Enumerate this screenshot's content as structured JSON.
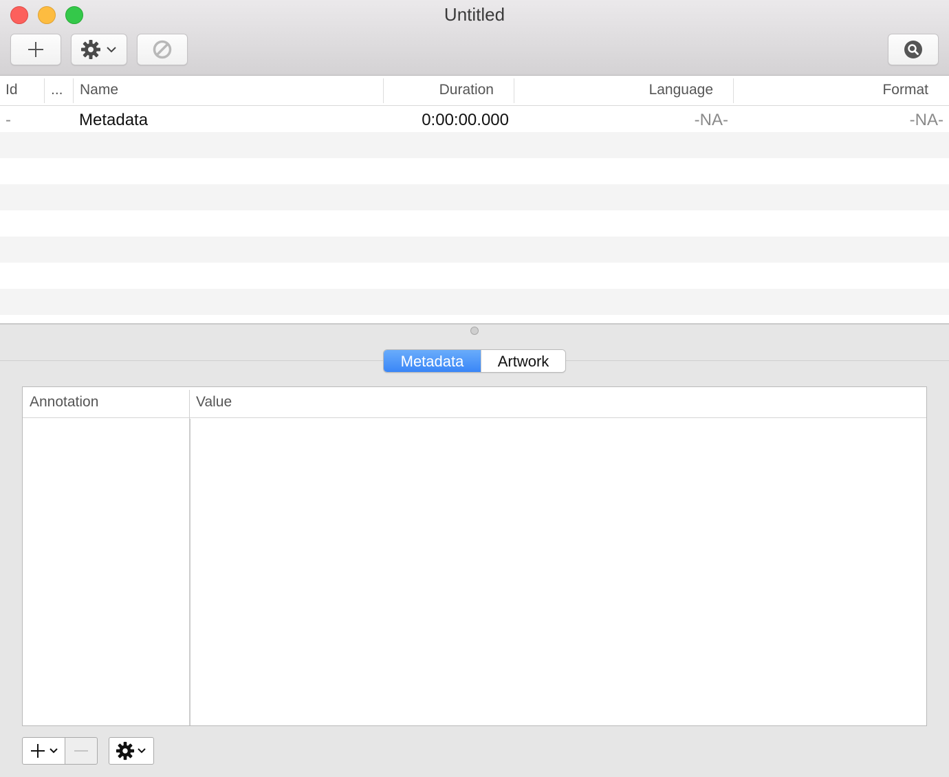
{
  "window": {
    "title": "Untitled"
  },
  "toolbar": {
    "buttons": [
      {
        "name": "add",
        "icon": "plus-icon"
      },
      {
        "name": "actions",
        "icon": "gear-dropdown-icon"
      },
      {
        "name": "cancel",
        "icon": "prohibited-icon"
      },
      {
        "name": "search",
        "icon": "magnifier-icon"
      }
    ]
  },
  "tracks": {
    "columns": [
      "Id",
      "...",
      "Name",
      "Duration",
      "Language",
      "Format"
    ],
    "rows": [
      {
        "id": "-",
        "name": "Metadata",
        "duration": "0:00:00.000",
        "language": "-NA-",
        "format": "-NA-"
      }
    ]
  },
  "tabs": {
    "items": [
      "Metadata",
      "Artwork"
    ],
    "selected": "Metadata"
  },
  "metadata_table": {
    "columns": [
      "Annotation",
      "Value"
    ],
    "rows": []
  },
  "footer": {
    "buttons": [
      {
        "name": "add-annotation",
        "icon": "plus-dropdown-icon"
      },
      {
        "name": "remove-annotation",
        "icon": "minus-icon",
        "enabled": false
      },
      {
        "name": "annotation-actions",
        "icon": "gear-dropdown-icon"
      }
    ]
  },
  "colors": {
    "accent": "#3a86f7",
    "close": "#fc605c",
    "minimize": "#fdbc40",
    "zoom": "#34c84a"
  }
}
